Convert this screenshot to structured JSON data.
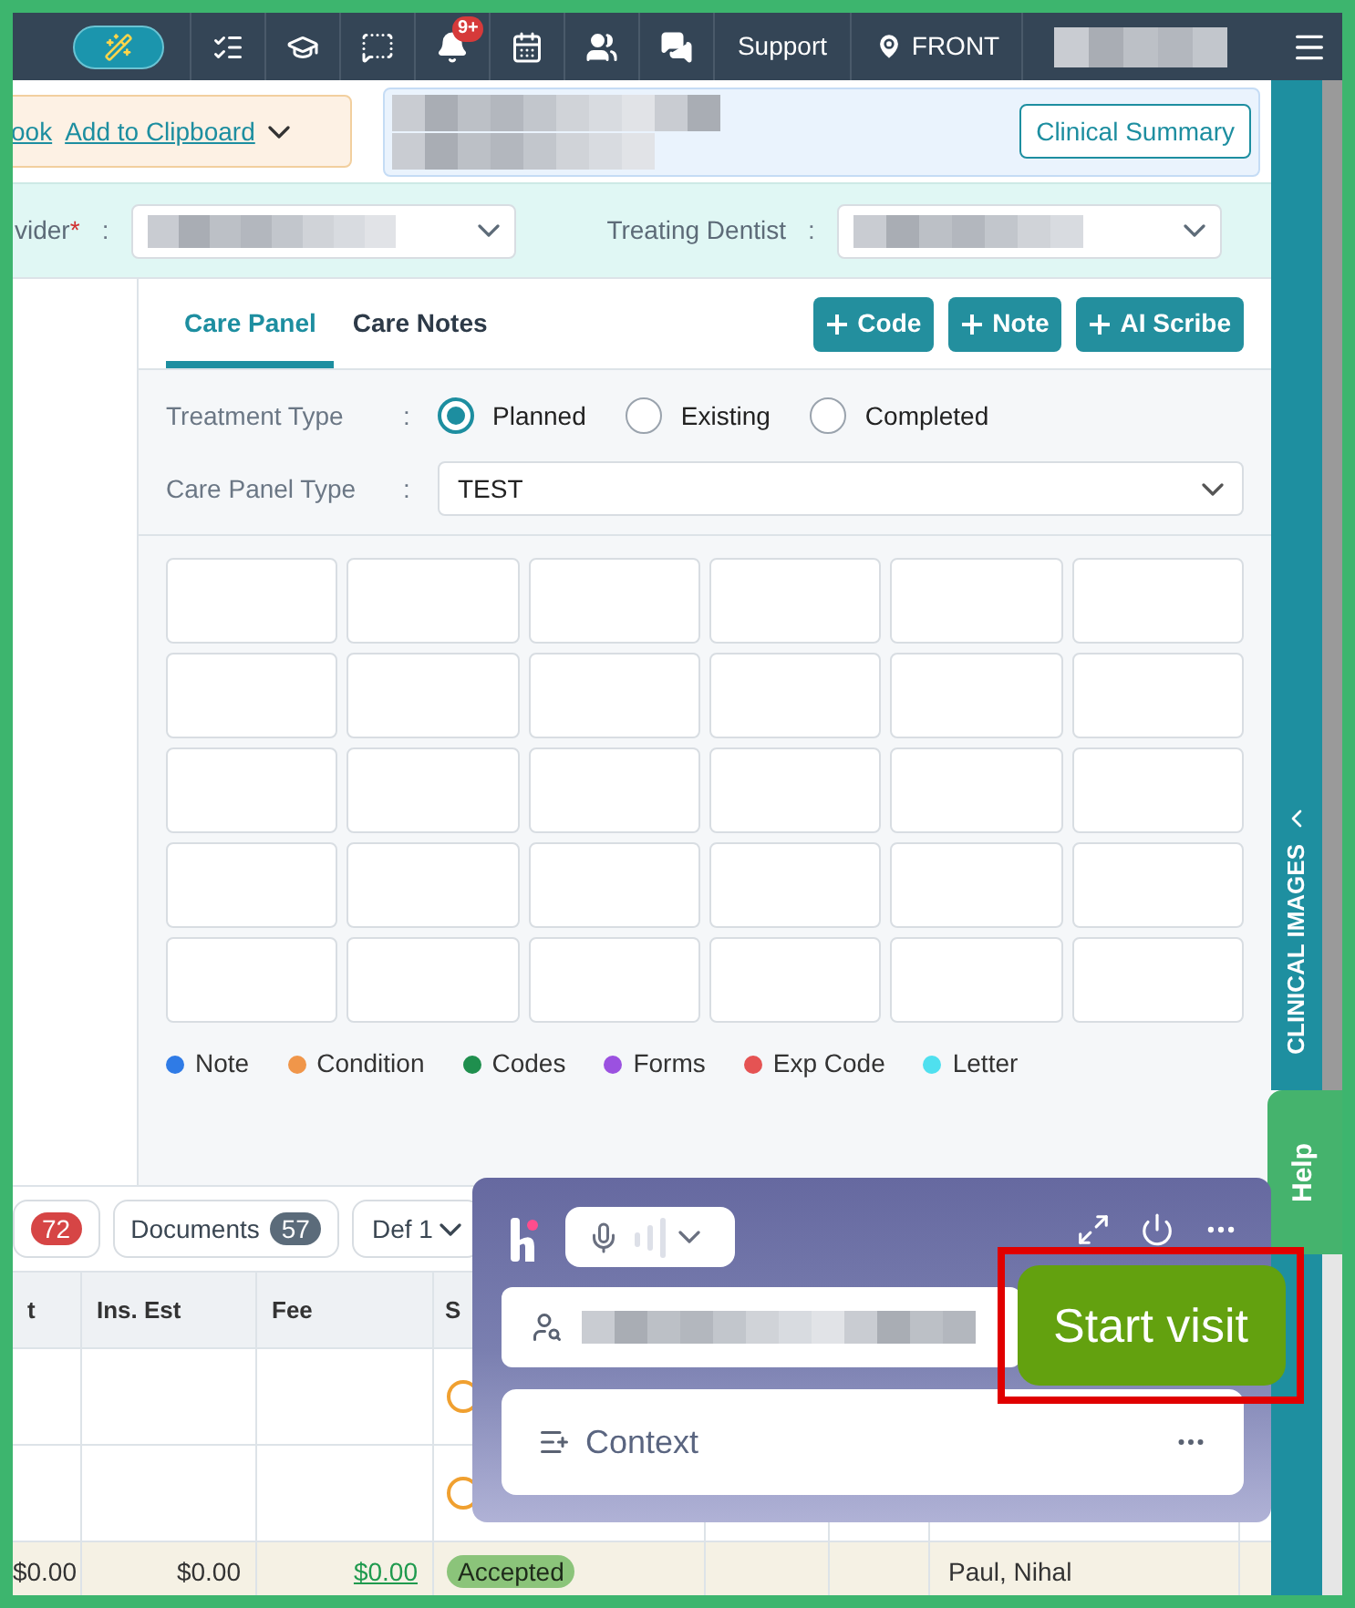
{
  "top_nav": {
    "bell_badge": "9+",
    "support": "Support",
    "location": "FRONT"
  },
  "toolbar": {
    "links": [
      "ook",
      "Add to Clipboard"
    ],
    "clinical_summary": "Clinical Summary"
  },
  "provider_row": {
    "fields": [
      {
        "label": "vider",
        "required": true,
        "required_mark": "*",
        "separator": ":"
      },
      {
        "label": "Treating Dentist",
        "required": false,
        "separator": ":"
      }
    ]
  },
  "care_panel": {
    "tabs": [
      {
        "label": "Care Panel",
        "selected": true
      },
      {
        "label": "Care Notes",
        "selected": false
      }
    ],
    "actions": [
      "Code",
      "Note",
      "AI Scribe"
    ],
    "treatment_type": {
      "label": "Treatment Type",
      "separator": ":",
      "options": [
        {
          "label": "Planned",
          "selected": true
        },
        {
          "label": "Existing",
          "selected": false
        },
        {
          "label": "Completed",
          "selected": false
        }
      ]
    },
    "care_panel_type": {
      "label": "Care Panel Type",
      "separator": ":",
      "value": "TEST"
    },
    "legend": [
      {
        "label": "Note",
        "color": "#2f7be6"
      },
      {
        "label": "Condition",
        "color": "#f0964a"
      },
      {
        "label": "Codes",
        "color": "#1f8f4e"
      },
      {
        "label": "Forms",
        "color": "#9b51e0"
      },
      {
        "label": "Exp Code",
        "color": "#e55353"
      },
      {
        "label": "Letter",
        "color": "#4fe0ef"
      }
    ]
  },
  "chips": [
    {
      "count": "72",
      "color": "#d64545"
    },
    {
      "label": "Documents",
      "count": "57",
      "color": "#5b6b7a"
    }
  ],
  "filter_dropdown": "Def 1",
  "table": {
    "columns": [
      "t",
      "Ins. Est",
      "Fee",
      "S"
    ],
    "rows": [
      {
        "highlighted": false,
        "status_icon": true,
        "cells": [
          "",
          "",
          "",
          "",
          "",
          ""
        ]
      },
      {
        "highlighted": false,
        "status_icon": true,
        "cells": [
          "",
          "",
          "",
          "",
          "",
          ""
        ]
      },
      {
        "highlighted": true,
        "status_icon": false,
        "status": "Accepted",
        "cells": [
          "$0.00",
          "$0.00",
          "$0.00",
          "",
          "",
          "Paul, Nihal"
        ]
      }
    ]
  },
  "scribe_widget": {
    "start_button": "Start visit",
    "context": "Context"
  },
  "side_tab": "CLINICAL IMAGES",
  "help_tab": "Help"
}
